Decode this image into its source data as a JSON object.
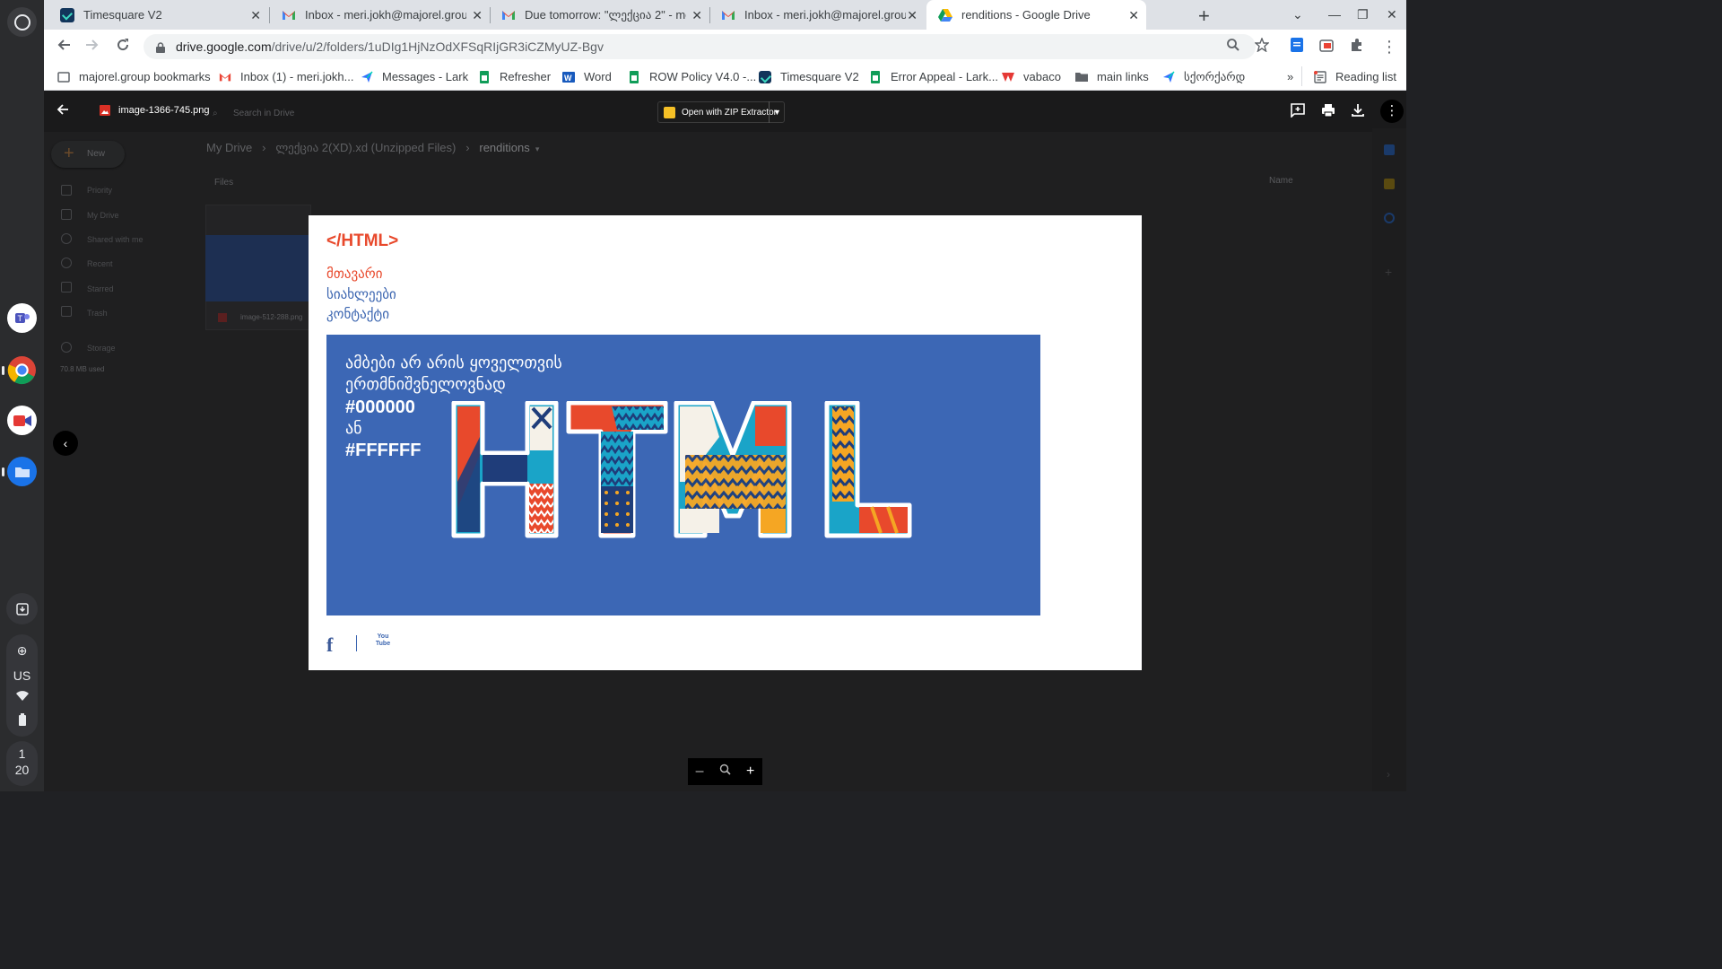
{
  "tabs": [
    {
      "title": "Timesquare V2",
      "favicon": "timesquare-icon"
    },
    {
      "title": "Inbox - meri.jokh@majorel.group",
      "favicon": "gmail-icon"
    },
    {
      "title": "Due tomorrow: \"ლექცია 2\" - me",
      "favicon": "gmail-icon"
    },
    {
      "title": "Inbox - meri.jokh@majorel.group",
      "favicon": "gmail-icon"
    },
    {
      "title": "renditions - Google Drive",
      "favicon": "google-drive-icon",
      "active": true
    }
  ],
  "address_bar": {
    "host": "drive.google.com",
    "path": "/drive/u/2/folders/1uDIg1HjNzOdXFSqRIjGR3iCZMyUZ-Bgv"
  },
  "bookmarks": [
    {
      "label": "majorel.group bookmarks",
      "icon": "bookmark-folder-icon"
    },
    {
      "label": "Inbox (1) - meri.jokh...",
      "icon": "gmail-icon"
    },
    {
      "label": "Messages - Lark",
      "icon": "lark-icon"
    },
    {
      "label": "Refresher",
      "icon": "sheets-icon"
    },
    {
      "label": "Word",
      "icon": "word-icon"
    },
    {
      "label": "ROW Policy V4.0 -...",
      "icon": "sheets-icon"
    },
    {
      "label": "Timesquare V2",
      "icon": "timesquare-icon"
    },
    {
      "label": "Error Appeal - Lark...",
      "icon": "sheets-icon"
    },
    {
      "label": "vabaco",
      "icon": "vabaco-icon"
    },
    {
      "label": "main links",
      "icon": "folder-icon"
    },
    {
      "label": "სქორქარდ",
      "icon": "lark-icon"
    }
  ],
  "bookmarks_overflow": "»",
  "reading_list": "Reading list",
  "viewer": {
    "file_name": "image-1366-745.png",
    "open_with": "Open with ZIP Extractor"
  },
  "drive_bg": {
    "search_placeholder": "Search in Drive",
    "new_label": "New",
    "breadcrumb": [
      "My Drive",
      "ლექცია 2(XD).xd (Unzipped Files)",
      "renditions"
    ],
    "files_header": "Files",
    "sort_label": "Name",
    "sidebar": [
      "Priority",
      "My Drive",
      "Shared with me",
      "Recent",
      "Starred",
      "Trash",
      "Storage"
    ],
    "storage_used": "70.8 MB used",
    "thumb_name": "image-512-288.png"
  },
  "preview": {
    "logo": "</HTML>",
    "nav": [
      "მთავარი",
      "სიახლეები",
      "კონტაქტი"
    ],
    "banner_lines": [
      "ამბები არ არის ყოველთვის",
      "ერთმნიშვნელოვნად",
      "#000000",
      "ან",
      "#FFFFFF"
    ],
    "banner_word": "HTML",
    "social_fb": "f",
    "social_yt": "You Tube"
  },
  "shelf": {
    "status_locale": "US",
    "clock_hour": "1",
    "clock_min": "20"
  },
  "colors": {
    "accent_red": "#e8492c",
    "banner_blue": "#3c67b5",
    "link_blue": "#3b65b0"
  }
}
